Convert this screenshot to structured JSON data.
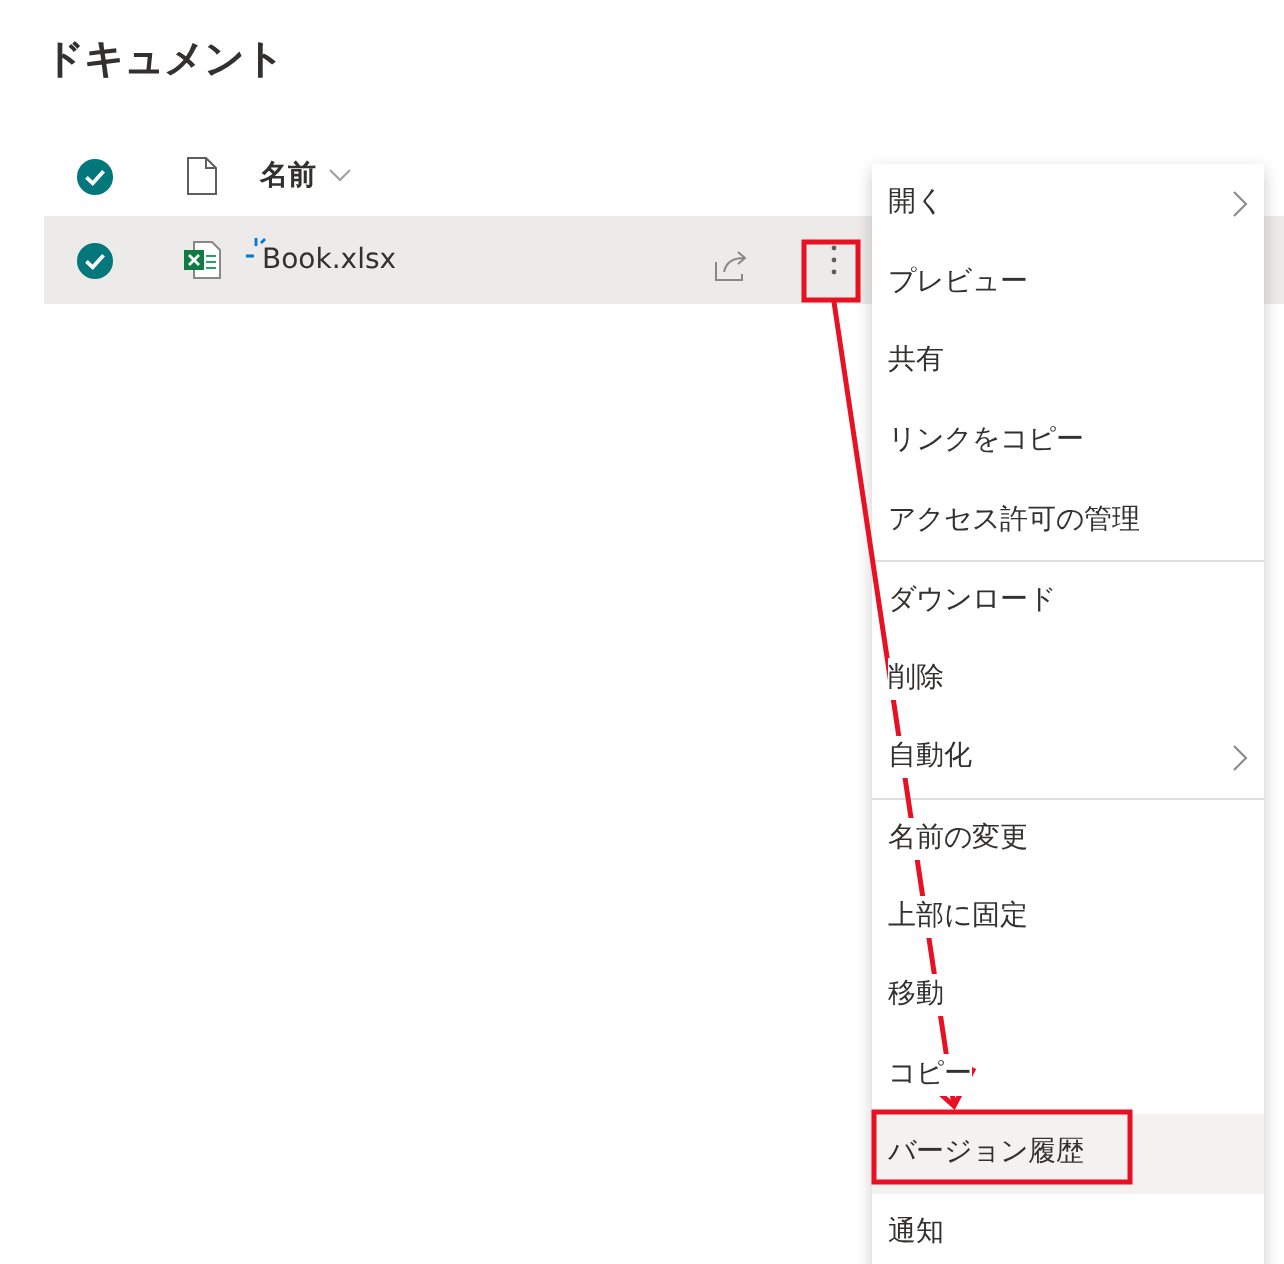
{
  "title": "ドキュメント",
  "header": {
    "name_label": "名前",
    "all_selected": true
  },
  "rows": [
    {
      "name": "Book.xlsx",
      "selected": true,
      "kind": "excel"
    }
  ],
  "context_menu": [
    {
      "label": "開く",
      "submenu": true,
      "divider_before": false,
      "selected": false
    },
    {
      "label": "プレビュー",
      "submenu": false,
      "divider_before": false,
      "selected": false
    },
    {
      "label": "共有",
      "submenu": false,
      "divider_before": false,
      "selected": false
    },
    {
      "label": "リンクをコピー",
      "submenu": false,
      "divider_before": false,
      "selected": false
    },
    {
      "label": "アクセス許可の管理",
      "submenu": false,
      "divider_before": false,
      "selected": false
    },
    {
      "label": "ダウンロード",
      "submenu": false,
      "divider_before": true,
      "selected": false
    },
    {
      "label": "削除",
      "submenu": false,
      "divider_before": false,
      "selected": false
    },
    {
      "label": "自動化",
      "submenu": true,
      "divider_before": false,
      "selected": false
    },
    {
      "label": "名前の変更",
      "submenu": false,
      "divider_before": true,
      "selected": false
    },
    {
      "label": "上部に固定",
      "submenu": false,
      "divider_before": false,
      "selected": false
    },
    {
      "label": "移動",
      "submenu": false,
      "divider_before": false,
      "selected": false
    },
    {
      "label": "コピー",
      "submenu": false,
      "divider_before": false,
      "selected": false
    },
    {
      "label": "バージョン履歴",
      "submenu": false,
      "divider_before": false,
      "selected": true
    },
    {
      "label": "通知",
      "submenu": false,
      "divider_before": false,
      "selected": false
    }
  ]
}
